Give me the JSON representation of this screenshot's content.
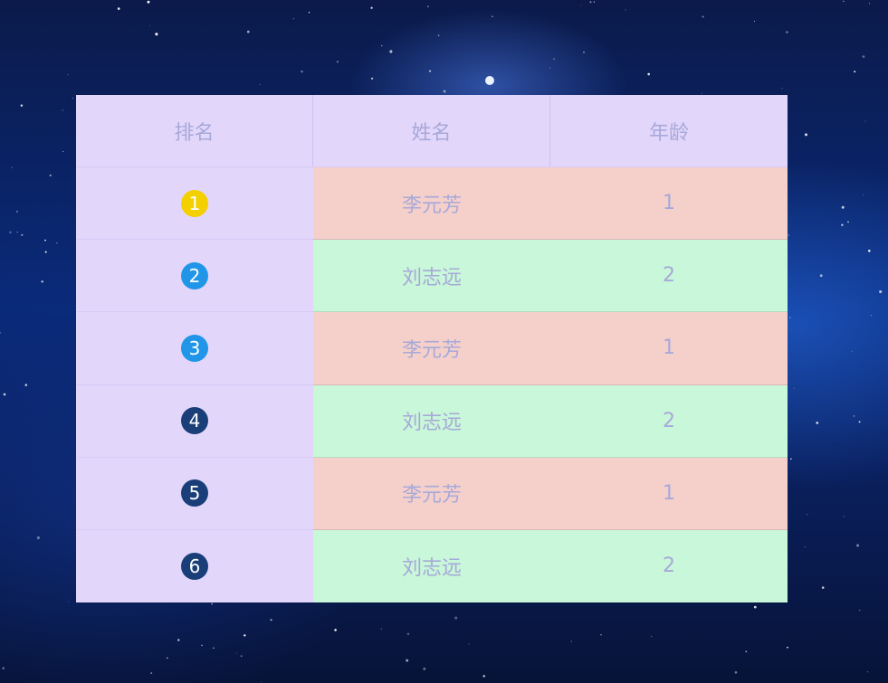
{
  "table": {
    "headers": {
      "rank": "排名",
      "name": "姓名",
      "age": "年龄"
    },
    "rows": [
      {
        "rank": "1",
        "name": "李元芳",
        "age": "1",
        "badge_color": "#f5d000",
        "row_color": "#f5d0cb"
      },
      {
        "rank": "2",
        "name": "刘志远",
        "age": "2",
        "badge_color": "#2196e8",
        "row_color": "#c9f7d9"
      },
      {
        "rank": "3",
        "name": "李元芳",
        "age": "1",
        "badge_color": "#2196e8",
        "row_color": "#f5d0cb"
      },
      {
        "rank": "4",
        "name": "刘志远",
        "age": "2",
        "badge_color": "#1a3f78",
        "row_color": "#c9f7d9"
      },
      {
        "rank": "5",
        "name": "李元芳",
        "age": "1",
        "badge_color": "#1a3f78",
        "row_color": "#f5d0cb"
      },
      {
        "rank": "6",
        "name": "刘志远",
        "age": "2",
        "badge_color": "#1a3f78",
        "row_color": "#c9f7d9"
      }
    ]
  },
  "colors": {
    "header_bg": "#e3d6fb",
    "text": "#a7a9d9",
    "gold": "#f5d000",
    "blue": "#2196e8",
    "navy": "#1a3f78"
  }
}
